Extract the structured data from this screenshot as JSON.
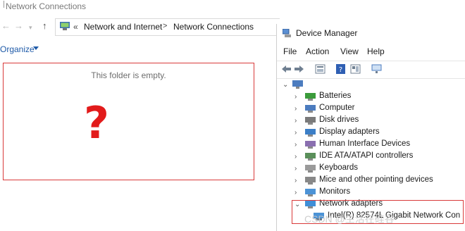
{
  "network_connections": {
    "title": "Network Connections",
    "breadcrumb": {
      "prefix": "«",
      "items": [
        "Network and Internet",
        "Network Connections"
      ],
      "separator": ">"
    },
    "command_bar": {
      "organize_label": "Organize"
    },
    "empty_message": "This folder is empty.",
    "annotation_mark": "?"
  },
  "device_manager": {
    "title": "Device Manager",
    "menu": [
      "File",
      "Action",
      "View",
      "Help"
    ],
    "root_label": "",
    "categories": [
      {
        "label": "Batteries",
        "icon": "battery-icon",
        "expanded": false
      },
      {
        "label": "Computer",
        "icon": "computer-icon",
        "expanded": false
      },
      {
        "label": "Disk drives",
        "icon": "disk-drive-icon",
        "expanded": false
      },
      {
        "label": "Display adapters",
        "icon": "display-adapter-icon",
        "expanded": false
      },
      {
        "label": "Human Interface Devices",
        "icon": "hid-icon",
        "expanded": false
      },
      {
        "label": "IDE ATA/ATAPI controllers",
        "icon": "ide-controller-icon",
        "expanded": false
      },
      {
        "label": "Keyboards",
        "icon": "keyboard-icon",
        "expanded": false
      },
      {
        "label": "Mice and other pointing devices",
        "icon": "mouse-icon",
        "expanded": false
      },
      {
        "label": "Monitors",
        "icon": "monitor-icon",
        "expanded": false
      },
      {
        "label": "Network adapters",
        "icon": "network-adapter-icon",
        "expanded": true
      }
    ],
    "network_child": "Intel(R) 82574L Gigabit Network Con"
  },
  "watermark": "CSDN @生活在硅谷",
  "colors": {
    "highlight": "#d93a3a",
    "question_mark": "#e21b1b",
    "link": "#1e5aa8"
  }
}
